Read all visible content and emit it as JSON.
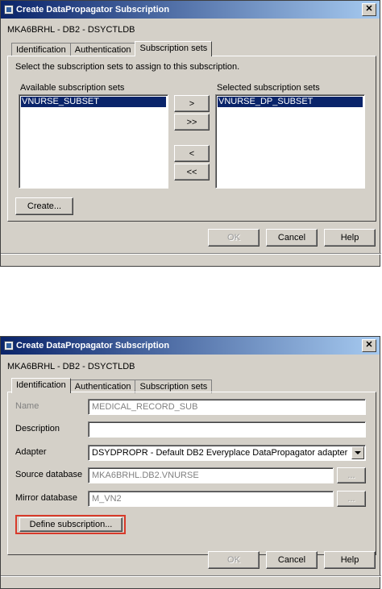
{
  "dialog1": {
    "title": "Create DataPropagator Subscription",
    "connection": "MKA6BRHL - DB2 - DSYCTLDB",
    "tabs": [
      "Identification",
      "Authentication",
      "Subscription sets"
    ],
    "instruction": "Select the subscription sets to assign to this subscription.",
    "available_label": "Available subscription sets",
    "available_items": [
      "VNURSE_SUBSET"
    ],
    "selected_label": "Selected subscription sets",
    "selected_items": [
      "VNURSE_DP_SUBSET"
    ],
    "move_buttons": {
      "add": ">",
      "add_all": ">>",
      "remove": "<",
      "remove_all": "<<"
    },
    "create_button": "Create...",
    "ok": "OK",
    "cancel": "Cancel",
    "help": "Help"
  },
  "dialog2": {
    "title": "Create DataPropagator Subscription",
    "connection": "MKA6BRHL - DB2 - DSYCTLDB",
    "tabs": [
      "Identification",
      "Authentication",
      "Subscription sets"
    ],
    "fields": {
      "name_label": "Name",
      "name_value": "MEDICAL_RECORD_SUB",
      "description_label": "Description",
      "description_value": "",
      "adapter_label": "Adapter",
      "adapter_value": "DSYDPROPR - Default DB2 Everyplace DataPropagator adapter",
      "source_label": "Source database",
      "source_value": "MKA6BRHL.DB2.VNURSE",
      "mirror_label": "Mirror database",
      "mirror_value": "M_VN2"
    },
    "browse_label": "...",
    "define_button": "Define subscription...",
    "ok": "OK",
    "cancel": "Cancel",
    "help": "Help",
    "highlight_color": "#d83a2a"
  },
  "colors": {
    "titlebar_start": "#0a246a",
    "titlebar_end": "#a6caf0",
    "dialog_bg": "#d4d0c8",
    "selection": "#0a246a"
  }
}
